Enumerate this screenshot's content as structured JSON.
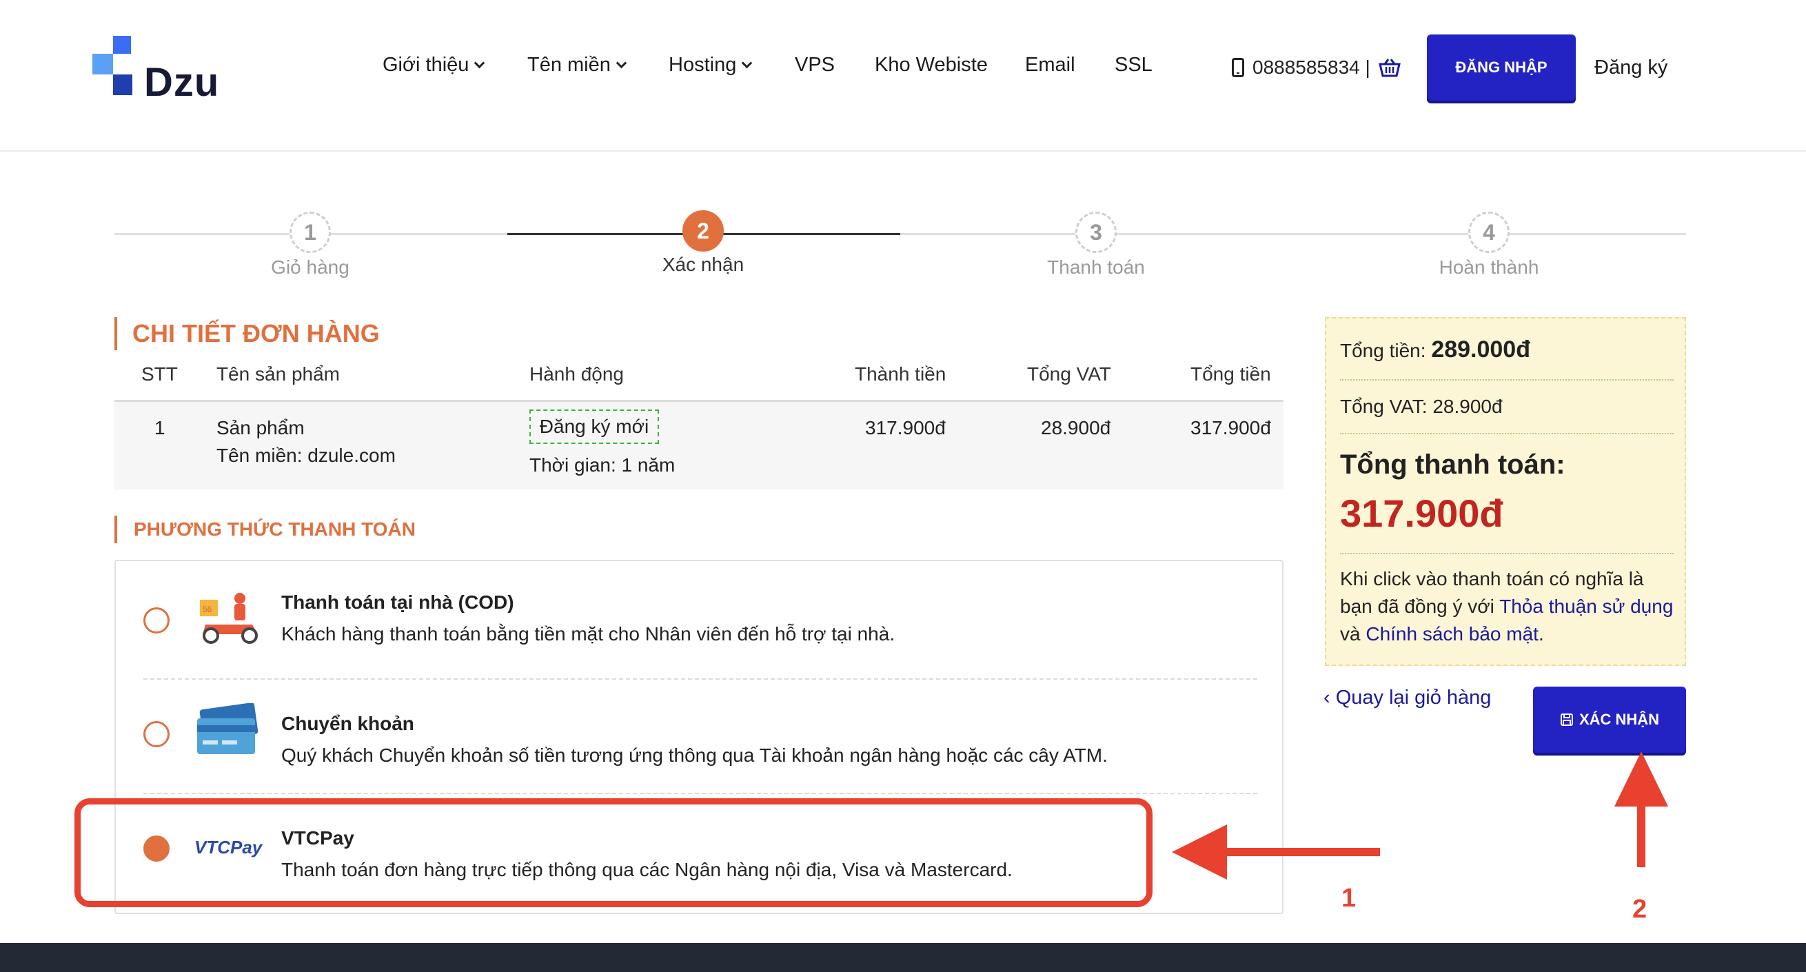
{
  "brand": {
    "name": "Dzu"
  },
  "nav": {
    "items": [
      {
        "label": "Giới thiệu",
        "dropdown": true
      },
      {
        "label": "Tên miền",
        "dropdown": true
      },
      {
        "label": "Hosting",
        "dropdown": true
      },
      {
        "label": "VPS",
        "dropdown": false
      },
      {
        "label": "Kho Webiste",
        "dropdown": false
      },
      {
        "label": "Email",
        "dropdown": false
      },
      {
        "label": "SSL",
        "dropdown": false
      }
    ],
    "phone": "0888585834 |",
    "login_label": "ĐĂNG NHẬP",
    "register_label": "Đăng ký"
  },
  "stepper": {
    "steps": [
      {
        "number": "1",
        "label": "Giỏ hàng",
        "active": false
      },
      {
        "number": "2",
        "label": "Xác nhận",
        "active": true
      },
      {
        "number": "3",
        "label": "Thanh toán",
        "active": false
      },
      {
        "number": "4",
        "label": "Hoàn thành",
        "active": false
      }
    ]
  },
  "order": {
    "title": "CHI TIẾT ĐƠN HÀNG",
    "columns": [
      "STT",
      "Tên sản phẩm",
      "Hành động",
      "Thành tiền",
      "Tổng VAT",
      "Tổng tiền"
    ],
    "rows": [
      {
        "stt": "1",
        "product": "Sản phẩm",
        "product_detail": "Tên miền: dzule.com",
        "action": "Đăng ký mới",
        "duration": "Thời gian: 1 năm",
        "subtotal": "317.900đ",
        "vat": "28.900đ",
        "total": "317.900đ"
      }
    ]
  },
  "payment": {
    "title": "PHƯƠNG THỨC THANH TOÁN",
    "selected": "vtcpay",
    "options": [
      {
        "id": "cod",
        "name": "Thanh toán tại nhà (COD)",
        "desc": "Khách hàng thanh toán bằng tiền mặt cho Nhân viên đến hỗ trợ tại nhà.",
        "icon": "delivery-scooter-icon"
      },
      {
        "id": "bank",
        "name": "Chuyển khoản",
        "desc": "Quý khách Chuyển khoản số tiền tương ứng thông qua Tài khoản ngân hàng hoặc các cây ATM.",
        "icon": "bank-card-icon"
      },
      {
        "id": "vtcpay",
        "name": "VTCPay",
        "desc": "Thanh toán đơn hàng trực tiếp thông qua các Ngân hàng nội địa, Visa và Mastercard.",
        "icon": "vtcpay-logo-icon",
        "logo_text": "VTCPay"
      }
    ]
  },
  "summary": {
    "subtotal_label": "Tổng tiền:",
    "subtotal_value": "289.000đ",
    "vat_text": "Tổng VAT: 28.900đ",
    "grand_label": "Tổng thanh toán:",
    "grand_value": "317.900đ",
    "note_prefix": "Khi click vào thanh toán có nghĩa là bạn đã đồng ý với ",
    "terms_link": "Thỏa thuận sử dụng",
    "note_and": " và ",
    "privacy_link": "Chính sách bảo mật",
    "note_suffix": "."
  },
  "actions": {
    "back_label": "Quay lại giỏ hàng",
    "confirm_label": "XÁC NHẬN"
  },
  "annotations": {
    "marker1": "1",
    "marker2": "2"
  },
  "colors": {
    "accent": "#e0703e",
    "primary": "#2323c4",
    "price": "#c0261f",
    "annotation": "#e8412f",
    "summary_bg": "#fcf5d6"
  }
}
